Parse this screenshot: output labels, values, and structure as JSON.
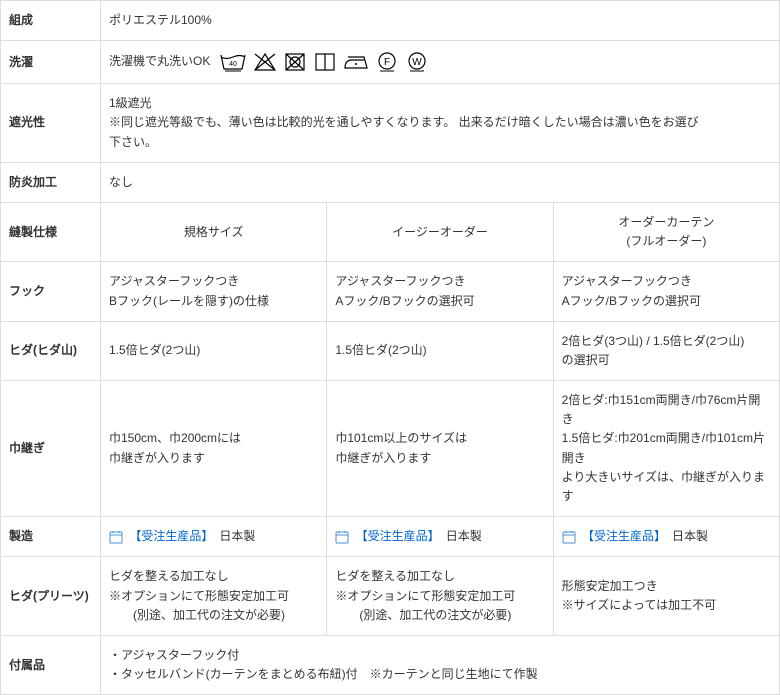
{
  "rows": {
    "composition": {
      "label": "組成",
      "value": "ポリエステル100%"
    },
    "washing": {
      "label": "洗濯",
      "value": "洗濯機で丸洗いOK "
    },
    "shading": {
      "label": "遮光性",
      "value": "1級遮光\n※同じ遮光等級でも、薄い色は比較的光を通しやすくなります。 出来るだけ暗くしたい場合は濃い色をお選び\n下さい。"
    },
    "flame": {
      "label": "防炎加工",
      "value": "なし"
    },
    "sewing": {
      "label": "縫製仕様"
    },
    "hook": {
      "label": "フック"
    },
    "pleat_m": {
      "label": "ヒダ(ヒダ山)"
    },
    "width_join": {
      "label": "巾継ぎ"
    },
    "mfg": {
      "label": "製造"
    },
    "pleat_p": {
      "label": "ヒダ(プリーツ)"
    },
    "accessories": {
      "label": "付属品",
      "value": "・アジャスターフック付\n・タッセルバンド(カーテンをまとめる布紐)付　※カーテンと同じ生地にて作製"
    }
  },
  "columns": {
    "standard": "規格サイズ",
    "easy": "イージーオーダー",
    "full": "オーダーカーテン\n(フルオーダー)"
  },
  "cells": {
    "hook": {
      "standard": "アジャスターフックつき\nBフック(レールを隠す)の仕様",
      "easy": "アジャスターフックつき\nAフック/Bフックの選択可",
      "full": "アジャスターフックつき\nAフック/Bフックの選択可"
    },
    "pleat_m": {
      "standard": "1.5倍ヒダ(2つ山)",
      "easy": "1.5倍ヒダ(2つ山)",
      "full": "2倍ヒダ(3つ山) / 1.5倍ヒダ(2つ山)\nの選択可"
    },
    "width_join": {
      "standard": "巾150cm、巾200cmには\n巾継ぎが入ります",
      "easy": "巾101cm以上のサイズは\n巾継ぎが入ります",
      "full": "2倍ヒダ:巾151cm両開き/巾76cm片開き\n1.5倍ヒダ:巾201cm両開き/巾101cm片開き\nより大きいサイズは、巾継ぎが入ります"
    },
    "mfg": {
      "link": "【受注生産品】",
      "country": "　日本製"
    },
    "pleat_p": {
      "standard": "ヒダを整える加工なし\n※オプションにて形態安定加工可\n　　(別途、加工代の注文が必要)",
      "easy": "ヒダを整える加工なし\n※オプションにて形態安定加工可\n　　(別途、加工代の注文が必要)",
      "full": "形態安定加工つき\n※サイズによっては加工不可"
    }
  }
}
